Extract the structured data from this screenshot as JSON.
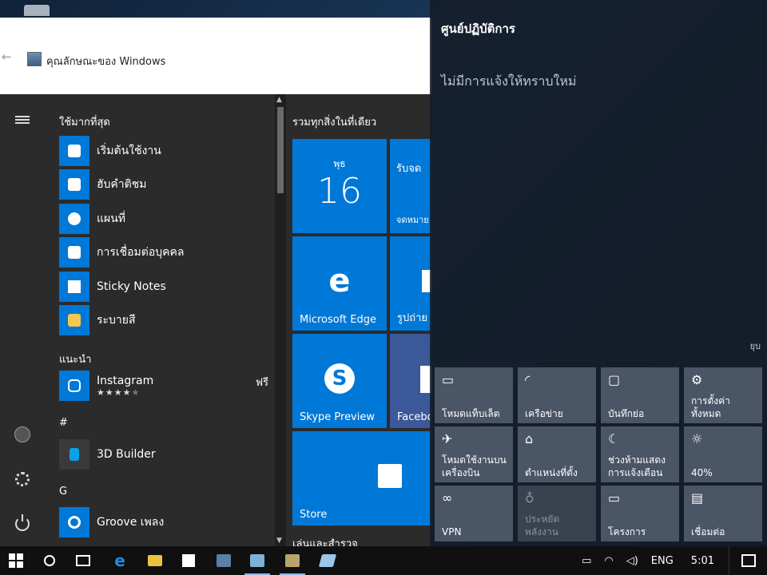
{
  "settings_window": {
    "title": "คุณลักษณะของ Windows"
  },
  "start_menu": {
    "most_used_heading": "ใช้มากที่สุด",
    "most_used": [
      {
        "label": "เริ่มต้นใช้งาน",
        "icon": "lightbulb-icon"
      },
      {
        "label": "ฮับคำติชม",
        "icon": "feedback-person-icon"
      },
      {
        "label": "แผนที่",
        "icon": "camera-map-icon"
      },
      {
        "label": "การเชื่อมต่อบุคคล",
        "icon": "people-icon"
      },
      {
        "label": "Sticky Notes",
        "icon": "sticky-note-icon"
      },
      {
        "label": "ระบายสี",
        "icon": "paint-palette-icon"
      }
    ],
    "suggested_heading": "แนะนำ",
    "suggested": {
      "label": "Instagram",
      "rating": "★★★★",
      "rating_empty": "★",
      "price": "ฟรี",
      "icon": "instagram-icon"
    },
    "hash_heading": "#",
    "hash_app": {
      "label": "3D Builder",
      "icon": "3d-builder-icon"
    },
    "g_heading": "G",
    "g_app": {
      "label": "Groove เพลง",
      "icon": "groove-music-icon"
    },
    "tiles_group_heading": "รวมทุกสิ่งในที่เดียว",
    "tiles_group_footer": "เล่นและสำรวจ",
    "calendar": {
      "day": "พุธ",
      "date": "16"
    },
    "mail_tile": {
      "top": "รับจด",
      "bottom": "จดหมาย"
    },
    "tiles": [
      {
        "label": "Microsoft Edge",
        "icon": "edge-icon"
      },
      {
        "label": "รูปถ่าย",
        "icon": "photos-icon"
      },
      {
        "label": "Skype Preview",
        "icon": "skype-icon"
      },
      {
        "label": "Facebo",
        "icon": "facebook-icon"
      },
      {
        "label": "Store",
        "icon": "store-bag-icon"
      }
    ]
  },
  "action_center": {
    "title": "ศูนย์ปฏิบัติการ",
    "empty_message": "ไม่มีการแจ้งให้ทราบใหม่",
    "collapse_label": "ยุบ",
    "quick_actions": [
      {
        "label": "โหมดแท็บเล็ต",
        "icon": "tablet-mode-icon",
        "state": "on"
      },
      {
        "label": "เครือข่าย",
        "icon": "network-icon",
        "state": "on"
      },
      {
        "label": "บันทึกย่อ",
        "icon": "note-icon",
        "state": "on"
      },
      {
        "label": "การตั้งค่าทั้งหมด",
        "icon": "settings-gear-icon",
        "state": "on"
      },
      {
        "label": "โหมดใช้งานบนเครื่องบิน",
        "icon": "airplane-icon",
        "state": "on"
      },
      {
        "label": "ตำแหน่งที่ตั้ง",
        "icon": "location-icon",
        "state": "on"
      },
      {
        "label": "ช่วงห้ามแสดงการแจ้งเตือน",
        "icon": "moon-icon",
        "state": "on"
      },
      {
        "label": "40%",
        "icon": "brightness-icon",
        "state": "on"
      },
      {
        "label": "VPN",
        "icon": "vpn-icon",
        "state": "on"
      },
      {
        "label": "ประหยัดพลังงาน",
        "icon": "battery-saver-icon",
        "state": "off"
      },
      {
        "label": "โครงการ",
        "icon": "project-icon",
        "state": "on"
      },
      {
        "label": "เชื่อมต่อ",
        "icon": "connect-icon",
        "state": "on"
      }
    ]
  },
  "taskbar": {
    "language": "ENG",
    "time": "5:01"
  },
  "colors": {
    "accent": "#0078d7",
    "start_bg": "#2b2b2b",
    "taskbar_bg": "#101010"
  }
}
